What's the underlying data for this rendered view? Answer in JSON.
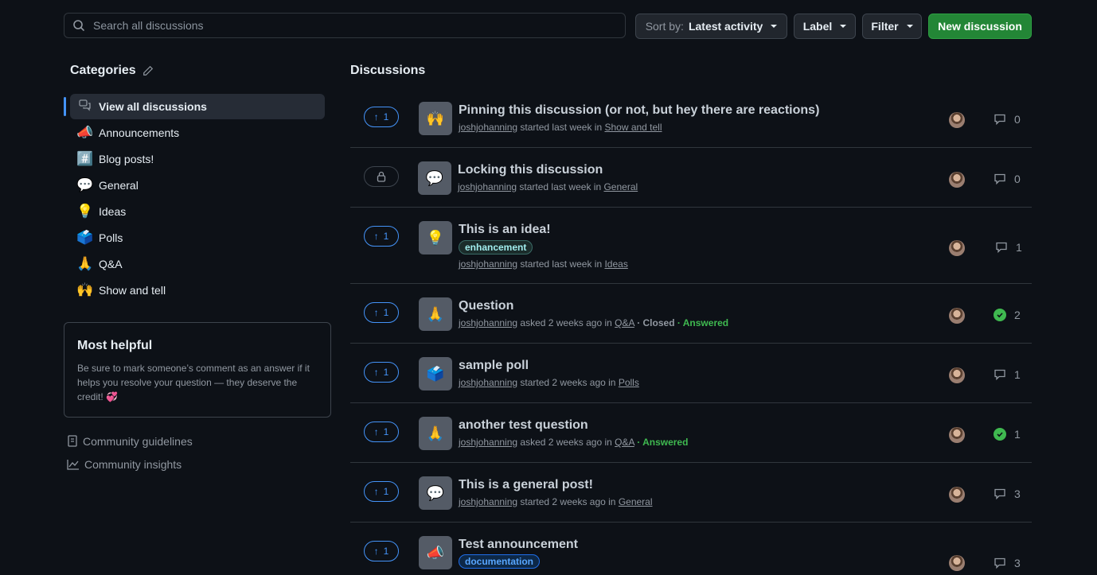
{
  "search": {
    "placeholder": "Search all discussions"
  },
  "toolbar": {
    "sort_prefix": "Sort by:",
    "sort_value": "Latest activity",
    "label_button": "Label",
    "filter_button": "Filter",
    "new_button": "New discussion"
  },
  "sidebar": {
    "title": "Categories",
    "items": [
      {
        "label": "View all discussions",
        "icon": "discussions-icon"
      },
      {
        "label": "Announcements",
        "emoji": "📣"
      },
      {
        "label": "Blog posts!",
        "emoji": "#️⃣"
      },
      {
        "label": "General",
        "emoji": "💬"
      },
      {
        "label": "Ideas",
        "emoji": "💡"
      },
      {
        "label": "Polls",
        "emoji": "🗳️"
      },
      {
        "label": "Q&A",
        "emoji": "🙏"
      },
      {
        "label": "Show and tell",
        "emoji": "🙌"
      }
    ],
    "helpful": {
      "title": "Most helpful",
      "text": "Be sure to mark someone’s comment as an answer if it helps you resolve your question — they deserve the credit! 💞"
    },
    "links": [
      "Community guidelines",
      "Community insights"
    ]
  },
  "main": {
    "title": "Discussions",
    "rows": [
      {
        "votes": "1",
        "emoji": "🙌",
        "title": "Pinning this discussion (or not, but hey there are reactions)",
        "author": "joshjohanning",
        "verb": "started last week in",
        "category": "Show and tell",
        "comments": "0"
      },
      {
        "votes": "",
        "emoji": "💬",
        "title": "Locking this discussion",
        "author": "joshjohanning",
        "verb": "started last week in",
        "category": "General",
        "comments": "0"
      },
      {
        "votes": "1",
        "emoji": "💡",
        "title": "This is an idea!",
        "label": "enhancement",
        "author": "joshjohanning",
        "verb": "started last week in",
        "category": "Ideas",
        "comments": "1"
      },
      {
        "votes": "1",
        "emoji": "🙏",
        "title": "Question",
        "author": "joshjohanning",
        "verb": "asked 2 weeks ago in",
        "category": "Q&A",
        "closed": "· Closed",
        "answered": "· Answered",
        "comments": "2"
      },
      {
        "votes": "1",
        "emoji": "🗳️",
        "title": "sample poll",
        "author": "joshjohanning",
        "verb": "started 2 weeks ago in",
        "category": "Polls",
        "comments": "1"
      },
      {
        "votes": "1",
        "emoji": "🙏",
        "title": "another test question",
        "author": "joshjohanning",
        "verb": "asked 2 weeks ago in",
        "category": "Q&A",
        "answered": "· Answered",
        "comments": "1"
      },
      {
        "votes": "1",
        "emoji": "💬",
        "title": "This is a general post!",
        "author": "joshjohanning",
        "verb": "started 2 weeks ago in",
        "category": "General",
        "comments": "3"
      },
      {
        "votes": "1",
        "emoji": "📣",
        "title": "Test announcement",
        "label": "documentation",
        "comments": "3"
      }
    ]
  }
}
